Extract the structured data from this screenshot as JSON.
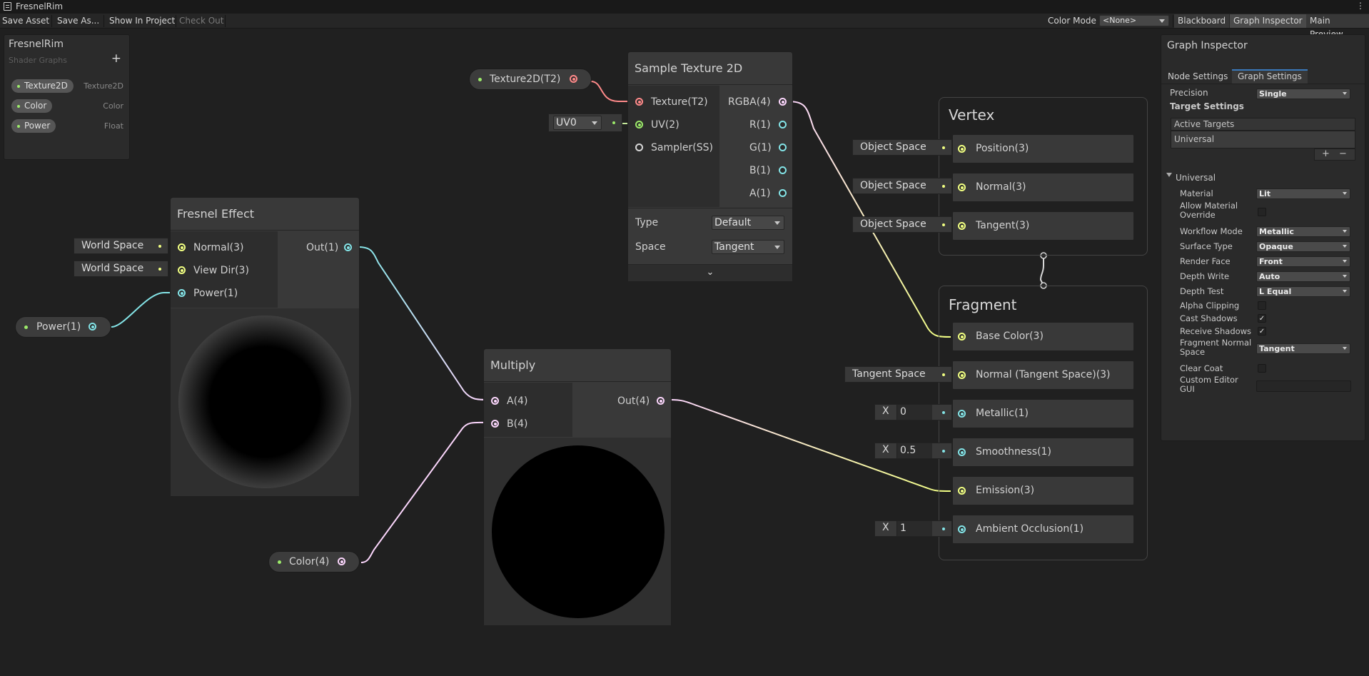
{
  "window": {
    "title": "FresnelRim"
  },
  "toolbar": {
    "save_asset": "Save Asset",
    "save_as": "Save As...",
    "show_in_project": "Show In Project",
    "check_out": "Check Out",
    "color_mode_label": "Color Mode",
    "color_mode_value": "<None>",
    "blackboard": "Blackboard",
    "graph_inspector": "Graph Inspector",
    "main_preview": "Main Preview"
  },
  "blackboard": {
    "title": "FresnelRim",
    "subtitle": "Shader Graphs",
    "add": "+",
    "properties": [
      {
        "name": "Texture2D",
        "type": "Texture2D"
      },
      {
        "name": "Color",
        "type": "Color"
      },
      {
        "name": "Power",
        "type": "Float"
      }
    ]
  },
  "graph": {
    "texture_prop": "Texture2D(T2)",
    "power_prop": "Power(1)",
    "color_prop": "Color(4)",
    "uv_dropdown": "UV0",
    "sample_texture": {
      "title": "Sample Texture 2D",
      "inputs": [
        "Texture(T2)",
        "UV(2)",
        "Sampler(SS)"
      ],
      "outputs": [
        "RGBA(4)",
        "R(1)",
        "G(1)",
        "B(1)",
        "A(1)"
      ],
      "type_label": "Type",
      "type_value": "Default",
      "space_label": "Space",
      "space_value": "Tangent",
      "expand": "⌄"
    },
    "fresnel": {
      "title": "Fresnel Effect",
      "inputs": [
        "Normal(3)",
        "View Dir(3)",
        "Power(1)"
      ],
      "output": "Out(1)",
      "normal_space": "World Space",
      "view_space": "World Space"
    },
    "multiply": {
      "title": "Multiply",
      "inputs": [
        "A(4)",
        "B(4)"
      ],
      "output": "Out(4)"
    },
    "vertex": {
      "title": "Vertex",
      "blocks": [
        {
          "label": "Position(3)",
          "space": "Object Space"
        },
        {
          "label": "Normal(3)",
          "space": "Object Space"
        },
        {
          "label": "Tangent(3)",
          "space": "Object Space"
        }
      ]
    },
    "fragment": {
      "title": "Fragment",
      "base_color": "Base Color(3)",
      "normal_ts": "Normal (Tangent Space)(3)",
      "normal_space": "Tangent Space",
      "metallic": "Metallic(1)",
      "metallic_x": "X",
      "metallic_val": "0",
      "smoothness": "Smoothness(1)",
      "smoothness_x": "X",
      "smoothness_val": "0.5",
      "emission": "Emission(3)",
      "ao": "Ambient Occlusion(1)",
      "ao_x": "X",
      "ao_val": "1"
    },
    "colors": {
      "float": "#84e4e7",
      "vector3": "#f1ff82",
      "vector4": "#fcd7fd",
      "texture": "#ff8a8a",
      "property_dot": "#9cea6a"
    }
  },
  "inspector": {
    "title": "Graph Inspector",
    "tabs": [
      "Node Settings",
      "Graph Settings"
    ],
    "active_tab": "Graph Settings",
    "precision_label": "Precision",
    "precision_value": "Single",
    "target_settings": "Target Settings",
    "active_targets": "Active Targets",
    "targets": [
      "Universal"
    ],
    "add_target": "+",
    "remove_target": "−",
    "section": "Universal",
    "props": {
      "material": {
        "label": "Material",
        "value": "Lit"
      },
      "allow_override": {
        "label": "Allow Material Override",
        "checked": false
      },
      "workflow": {
        "label": "Workflow Mode",
        "value": "Metallic"
      },
      "surface": {
        "label": "Surface Type",
        "value": "Opaque"
      },
      "render_face": {
        "label": "Render Face",
        "value": "Front"
      },
      "depth_write": {
        "label": "Depth Write",
        "value": "Auto"
      },
      "depth_test": {
        "label": "Depth Test",
        "value": "L Equal"
      },
      "alpha_clip": {
        "label": "Alpha Clipping",
        "checked": false
      },
      "cast_shadows": {
        "label": "Cast Shadows",
        "checked": true
      },
      "receive_shadows": {
        "label": "Receive Shadows",
        "checked": true
      },
      "frag_normal_space": {
        "label": "Fragment Normal Space",
        "value": "Tangent"
      },
      "clear_coat": {
        "label": "Clear Coat",
        "checked": false
      },
      "custom_gui": {
        "label": "Custom Editor GUI",
        "value": ""
      }
    },
    "check_glyph": "✓"
  }
}
